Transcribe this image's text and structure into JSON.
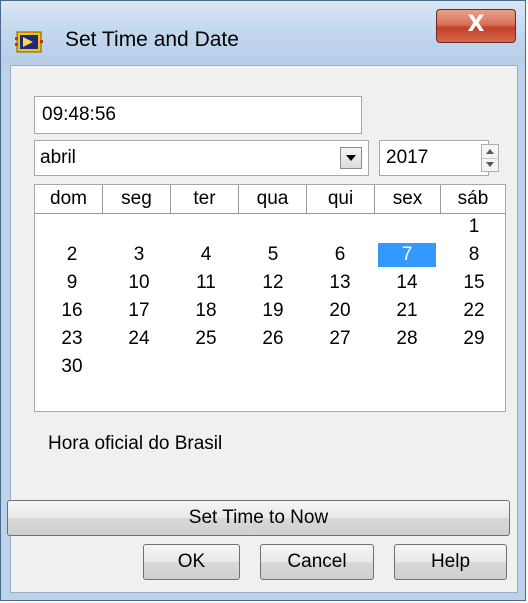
{
  "window": {
    "title": "Set Time and Date",
    "close_label": "X"
  },
  "time": {
    "value": "09:48:56"
  },
  "month": {
    "selected": "abril"
  },
  "year": {
    "value": "2017"
  },
  "calendar": {
    "day_names": [
      "dom",
      "seg",
      "ter",
      "qua",
      "qui",
      "sex",
      "sáb"
    ],
    "weeks": [
      [
        "",
        "",
        "",
        "",
        "",
        "",
        "1"
      ],
      [
        "2",
        "3",
        "4",
        "5",
        "6",
        "7",
        "8"
      ],
      [
        "9",
        "10",
        "11",
        "12",
        "13",
        "14",
        "15"
      ],
      [
        "16",
        "17",
        "18",
        "19",
        "20",
        "21",
        "22"
      ],
      [
        "23",
        "24",
        "25",
        "26",
        "27",
        "28",
        "29"
      ],
      [
        "30",
        "",
        "",
        "",
        "",
        "",
        ""
      ]
    ],
    "selected_day": "7",
    "selection_color": "#3399ff"
  },
  "timezone_label": "Hora oficial do Brasil",
  "buttons": {
    "set_now": "Set Time to Now",
    "ok": "OK",
    "cancel": "Cancel",
    "help": "Help"
  }
}
